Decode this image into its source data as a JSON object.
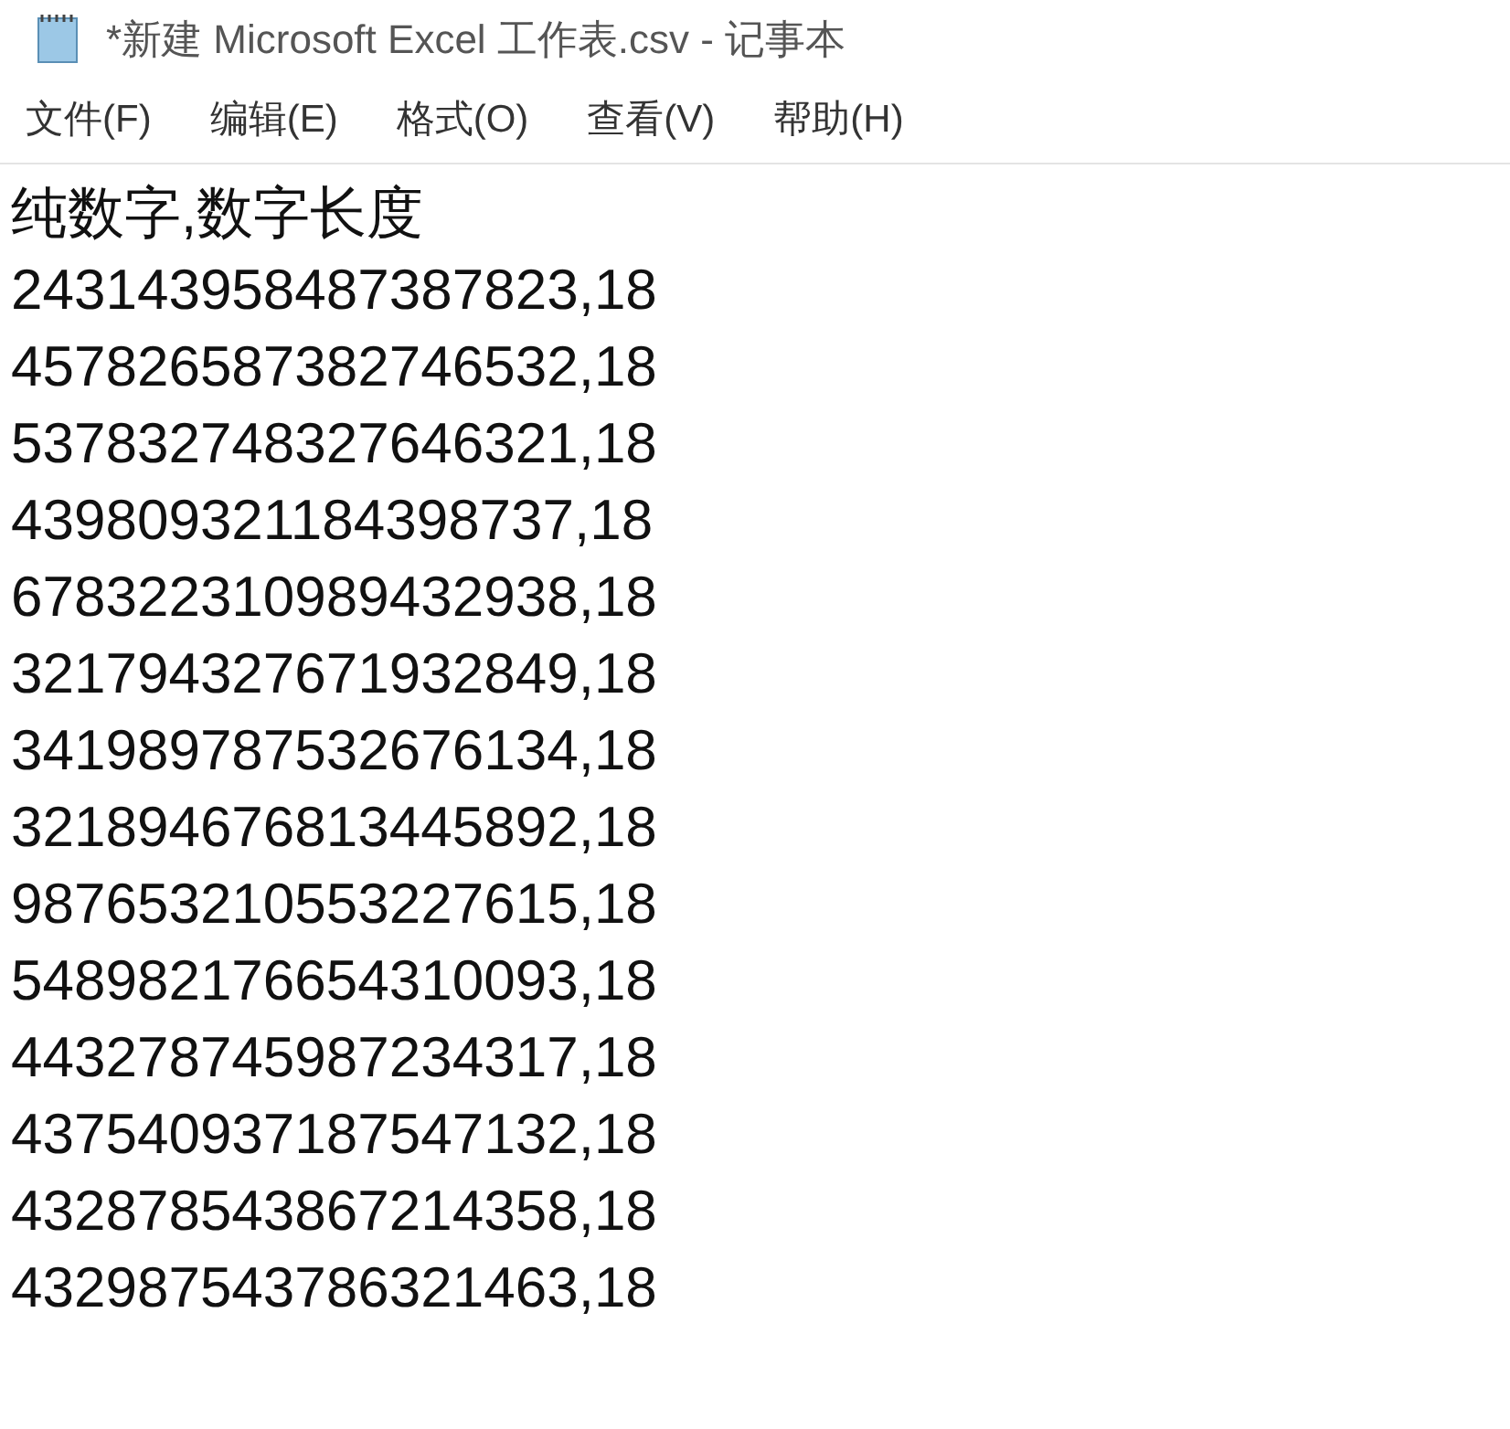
{
  "window": {
    "title": "*新建 Microsoft Excel 工作表.csv - 记事本"
  },
  "menu": [
    "文件(F)",
    "编辑(E)",
    "格式(O)",
    "查看(V)",
    "帮助(H)"
  ],
  "lines": [
    "纯数字,数字长度",
    "243143958487387823,18",
    "457826587382746532,18",
    "537832748327646321,18",
    "439809321184398737,18",
    "678322310989432938,18",
    "321794327671932849,18",
    "341989787532676134,18",
    "321894676813445892,18",
    "987653210553227615,18",
    "548982176654310093,18",
    "443278745987234317,18",
    "437540937187547132,18",
    "432878543867214358,18",
    "432987543786321463,18"
  ]
}
